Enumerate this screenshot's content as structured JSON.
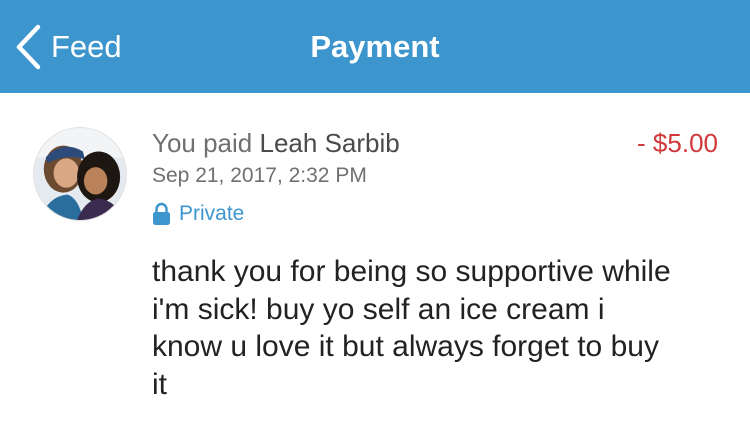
{
  "navbar": {
    "back_label": "Feed",
    "title": "Payment",
    "color": "#3d95ce"
  },
  "payment": {
    "action": "You paid",
    "recipient": "Leah Sarbib",
    "amount": "- $5.00",
    "date": "Sep 21, 2017, 2:32 PM",
    "privacy": "Private",
    "note": "thank you for being so supportive while i'm sick! buy yo self an ice cream i know u love it but always forget to buy it",
    "amount_color": "#d0383a",
    "privacy_color": "#3d95ce",
    "avatar_icon": "user-photo-avatar",
    "privacy_icon": "lock-icon"
  }
}
